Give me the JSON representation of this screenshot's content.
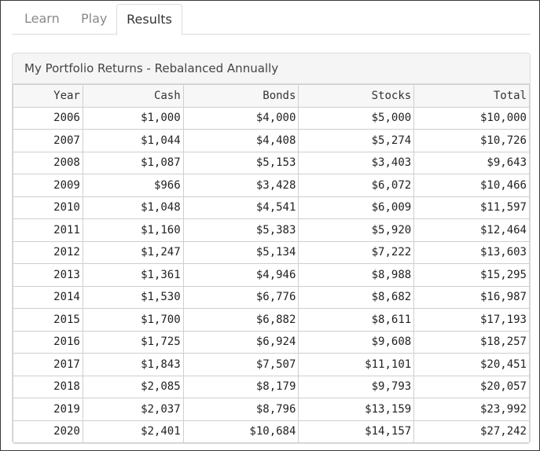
{
  "tabs": [
    {
      "label": "Learn"
    },
    {
      "label": "Play"
    },
    {
      "label": "Results"
    }
  ],
  "active_tab": "Results",
  "panel": {
    "title": "My Portfolio Returns - Rebalanced Annually"
  },
  "table": {
    "columns": [
      "Year",
      "Cash",
      "Bonds",
      "Stocks",
      "Total"
    ],
    "rows": [
      [
        "2006",
        "$1,000",
        "$4,000",
        "$5,000",
        "$10,000"
      ],
      [
        "2007",
        "$1,044",
        "$4,408",
        "$5,274",
        "$10,726"
      ],
      [
        "2008",
        "$1,087",
        "$5,153",
        "$3,403",
        "$9,643"
      ],
      [
        "2009",
        "$966",
        "$3,428",
        "$6,072",
        "$10,466"
      ],
      [
        "2010",
        "$1,048",
        "$4,541",
        "$6,009",
        "$11,597"
      ],
      [
        "2011",
        "$1,160",
        "$5,383",
        "$5,920",
        "$12,464"
      ],
      [
        "2012",
        "$1,247",
        "$5,134",
        "$7,222",
        "$13,603"
      ],
      [
        "2013",
        "$1,361",
        "$4,946",
        "$8,988",
        "$15,295"
      ],
      [
        "2014",
        "$1,530",
        "$6,776",
        "$8,682",
        "$16,987"
      ],
      [
        "2015",
        "$1,700",
        "$6,882",
        "$8,611",
        "$17,193"
      ],
      [
        "2016",
        "$1,725",
        "$6,924",
        "$9,608",
        "$18,257"
      ],
      [
        "2017",
        "$1,843",
        "$7,507",
        "$11,101",
        "$20,451"
      ],
      [
        "2018",
        "$2,085",
        "$8,179",
        "$9,793",
        "$20,057"
      ],
      [
        "2019",
        "$2,037",
        "$8,796",
        "$13,159",
        "$23,992"
      ],
      [
        "2020",
        "$2,401",
        "$10,684",
        "$14,157",
        "$27,242"
      ]
    ]
  }
}
